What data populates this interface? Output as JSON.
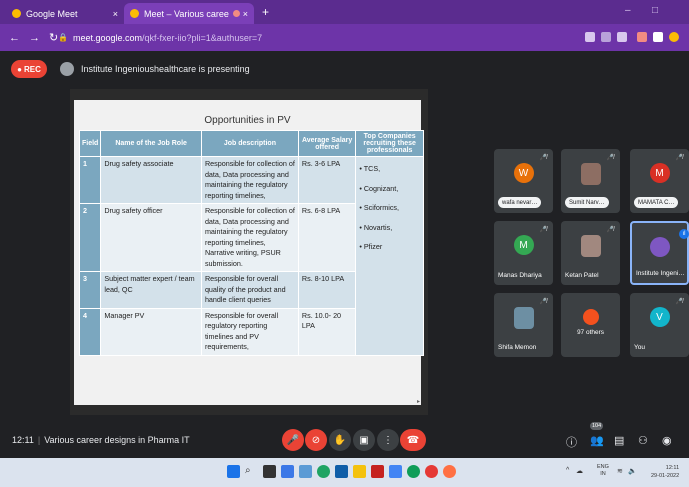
{
  "browser": {
    "tabs": [
      {
        "label": "Google Meet",
        "close": "×"
      },
      {
        "label": "Meet – Various career desig…",
        "close": "×"
      }
    ],
    "new_tab": "+",
    "window_controls": {
      "minimize": "–",
      "maximize": "□"
    },
    "url_host": "meet.google.com",
    "url_path": "/qkf-fxer-iio?pli=1&authuser=7"
  },
  "meet_header": {
    "rec_label": "REC",
    "presenting_text": "Institute Ingenioushealthcare is presenting"
  },
  "slide": {
    "title": "Opportunities in PV",
    "headers": [
      "Field",
      "Name of the Job Role",
      "Job description",
      "Average Salary offered",
      "Top Companies recruiting these professionals"
    ],
    "rows": [
      {
        "field": "1",
        "role": "Drug safety associate",
        "description": "Responsible for collection of data, Data processing and maintaining the regulatory reporting timelines,",
        "salary": "Rs. 3-6 LPA"
      },
      {
        "field": "2",
        "role": "Drug safety officer",
        "description": "Responsible for collection of data, Data processing and maintaining the regulatory reporting timelines, Narrative writing, PSUR submission.",
        "salary": "Rs. 6-8 LPA"
      },
      {
        "field": "3",
        "role": "Subject matter expert / team lead, QC",
        "description": "Responsible for overall quality of the product and handle client queries",
        "salary": "Rs. 8-10 LPA"
      },
      {
        "field": "4",
        "role": "Manager PV",
        "description": "Responsible for overall regulatory reporting timelines and PV requirements,",
        "salary": "Rs. 10.0- 20 LPA"
      }
    ],
    "companies": [
      "TCS,",
      "Cognizant,",
      "Sciformics,",
      "Novartis,",
      "Pfizer"
    ]
  },
  "participants": [
    {
      "name": "wafa nevar…",
      "initial": "W",
      "color": "#e8710a"
    },
    {
      "name": "Sumit Narv…",
      "initial": "",
      "color": "#8d6e63"
    },
    {
      "name": "MAMATA C…",
      "initial": "M",
      "color": "#d93025"
    },
    {
      "name": "Manas Dhariya",
      "initial": "M",
      "color": "#34a853"
    },
    {
      "name": "Ketan Patel",
      "initial": "",
      "color": "#a1887f"
    },
    {
      "name": "Institute Ingeni…",
      "initial": "",
      "color": "#7e57c2"
    },
    {
      "name": "Shifa Memon",
      "initial": "",
      "color": "#6d8fa3"
    },
    {
      "name": "97 others",
      "initial": "",
      "color": "#f4511e"
    },
    {
      "name": "You",
      "initial": "V",
      "color": "#12b5cb"
    }
  ],
  "controls": {
    "time": "12:11",
    "meeting_name": "Various career designs in Pharma IT",
    "participants_count": "104"
  },
  "taskbar": {
    "lang_line1": "ENG",
    "lang_line2": "IN",
    "time": "12:11",
    "date": "29-01-2022"
  }
}
